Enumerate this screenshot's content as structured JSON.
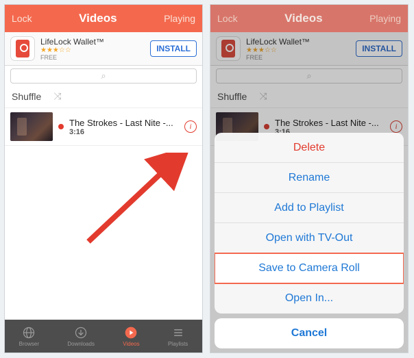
{
  "nav": {
    "left": "Lock",
    "title": "Videos",
    "right": "Playing"
  },
  "ad": {
    "title": "LifeLock Wallet™",
    "stars": "★★★☆☆",
    "free": "FREE",
    "cta": "INSTALL"
  },
  "search": {
    "icon": "⌕"
  },
  "shuffle": {
    "label": "Shuffle",
    "icon": "⤨"
  },
  "video": {
    "title": "The Strokes - Last Nite -...",
    "duration": "3:16",
    "info": "i"
  },
  "tabs": {
    "browser": "Browser",
    "downloads": "Downloads",
    "videos": "Videos",
    "playlists": "Playlists"
  },
  "sheet": {
    "delete": "Delete",
    "rename": "Rename",
    "add": "Add to Playlist",
    "tvout": "Open with TV-Out",
    "save": "Save to Camera Roll",
    "openin": "Open In...",
    "cancel": "Cancel"
  }
}
